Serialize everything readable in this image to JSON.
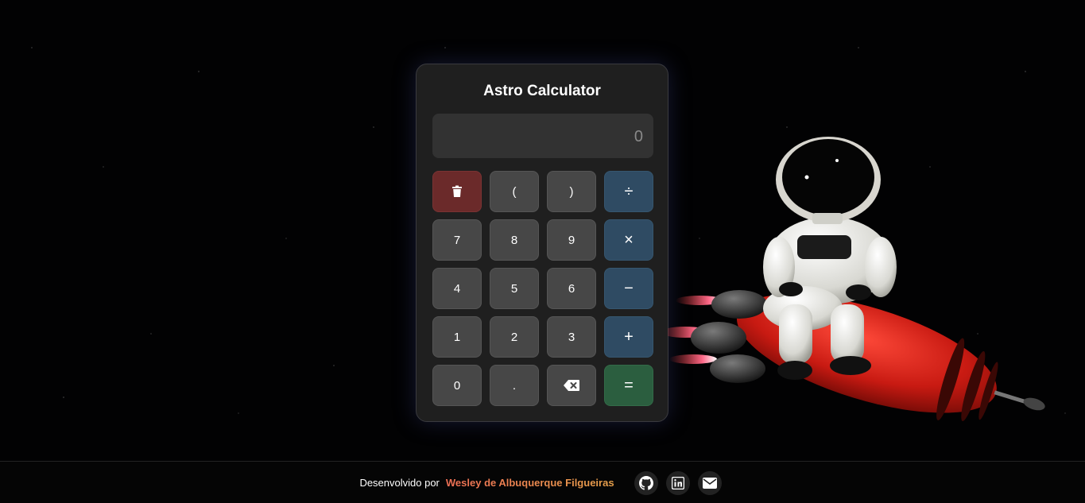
{
  "calculator": {
    "title": "Astro Calculator",
    "display_value": "0",
    "keys": [
      {
        "label": "",
        "icon": "trash-icon",
        "kind": "clear"
      },
      {
        "label": "(",
        "kind": "num"
      },
      {
        "label": ")",
        "kind": "num"
      },
      {
        "label": "÷",
        "kind": "op"
      },
      {
        "label": "7",
        "kind": "num"
      },
      {
        "label": "8",
        "kind": "num"
      },
      {
        "label": "9",
        "kind": "num"
      },
      {
        "label": "×",
        "kind": "op"
      },
      {
        "label": "4",
        "kind": "num"
      },
      {
        "label": "5",
        "kind": "num"
      },
      {
        "label": "6",
        "kind": "num"
      },
      {
        "label": "−",
        "kind": "op"
      },
      {
        "label": "1",
        "kind": "num"
      },
      {
        "label": "2",
        "kind": "num"
      },
      {
        "label": "3",
        "kind": "num"
      },
      {
        "label": "+",
        "kind": "op"
      },
      {
        "label": "0",
        "kind": "num"
      },
      {
        "label": ".",
        "kind": "num"
      },
      {
        "label": "",
        "icon": "backspace-icon",
        "kind": "num"
      },
      {
        "label": "=",
        "kind": "equals"
      }
    ]
  },
  "footer": {
    "prefix": "Desenvolvido por",
    "author": "Wesley de Albuquerque Filgueiras",
    "social": [
      {
        "icon": "github-icon"
      },
      {
        "icon": "linkedin-icon"
      },
      {
        "icon": "email-icon"
      }
    ]
  },
  "colors": {
    "clear": "#6b2a2a",
    "operator": "#2f4b63",
    "equals": "#2b5e3f",
    "number": "#474747",
    "author_gradient_start": "#ef6f55",
    "author_gradient_end": "#e8a14b"
  }
}
